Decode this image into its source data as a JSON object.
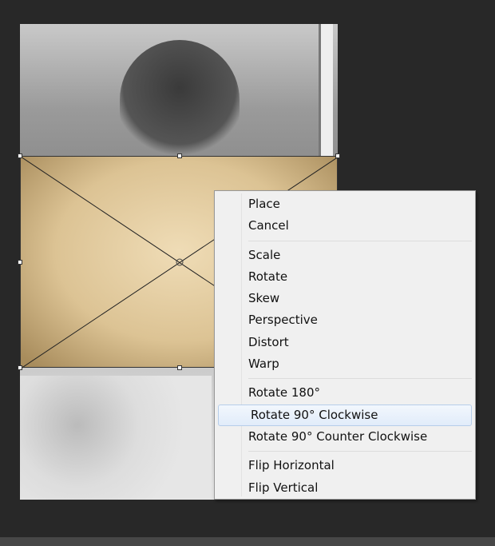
{
  "context_menu": {
    "groups": [
      [
        "Place",
        "Cancel"
      ],
      [
        "Scale",
        "Rotate",
        "Skew",
        "Perspective",
        "Distort",
        "Warp"
      ],
      [
        "Rotate 180°",
        "Rotate 90° Clockwise",
        "Rotate 90° Counter Clockwise"
      ],
      [
        "Flip Horizontal",
        "Flip Vertical"
      ]
    ],
    "highlighted": "Rotate 90° Clockwise"
  }
}
